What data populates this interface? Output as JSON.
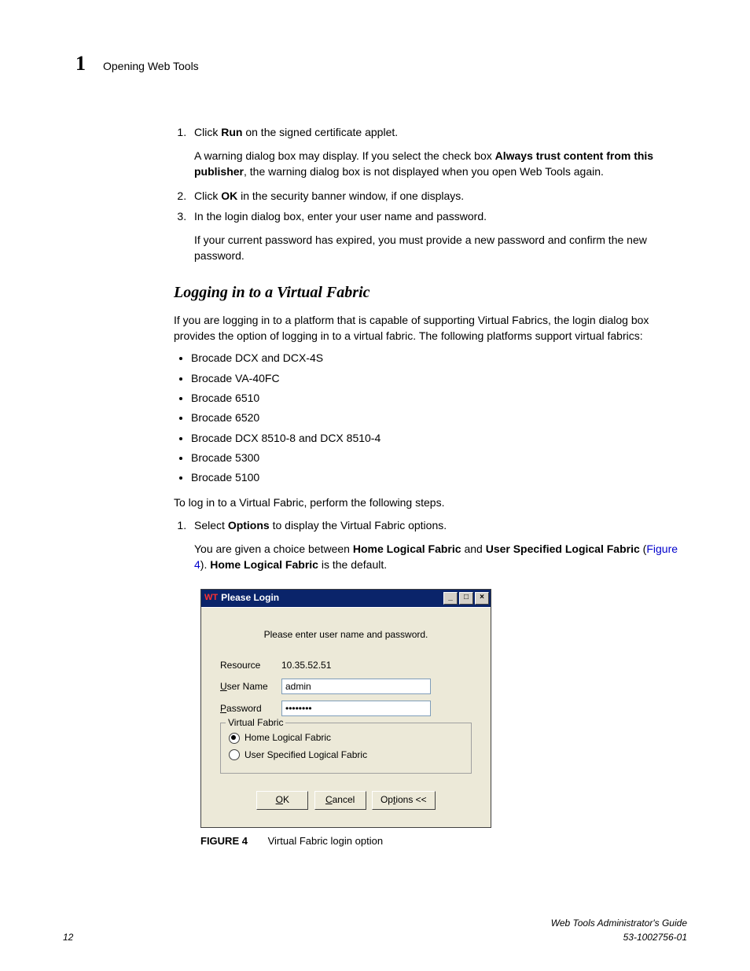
{
  "header": {
    "chapter_number": "1",
    "section_title": "Opening Web Tools"
  },
  "step1": {
    "num": "1.",
    "pre": "Click ",
    "bold": "Run",
    "post": " on the signed certificate applet.",
    "note_pre": "A warning dialog box may display. If you select the check box ",
    "note_bold": "Always trust content from this publisher",
    "note_post": ", the warning dialog box is not displayed when you open Web Tools again."
  },
  "step2": {
    "pre": "Click ",
    "bold": "OK",
    "post": " in the security banner window, if one displays."
  },
  "step3": {
    "text": "In the login dialog box, enter your user name and password.",
    "note": "If your current password has expired, you must provide a new password and confirm the new password."
  },
  "heading2": "Logging in to a Virtual Fabric",
  "vf_intro": "If you are logging in to a platform that is capable of supporting Virtual Fabrics, the login dialog box provides the option of logging in to a virtual fabric. The following platforms support virtual fabrics:",
  "vf_platforms": [
    "Brocade DCX and DCX-4S",
    "Brocade VA-40FC",
    "Brocade 6510",
    "Brocade 6520",
    "Brocade DCX 8510-8 and DCX 8510-4",
    "Brocade 5300",
    "Brocade 5100"
  ],
  "vf_lead": "To log in to a Virtual Fabric, perform the following steps.",
  "vf_step1": {
    "pre": "Select ",
    "bold": "Options",
    "post": " to display the Virtual Fabric options.",
    "choice_pre": "You are given a choice between ",
    "choice_b1": "Home Logical Fabric",
    "choice_mid": " and ",
    "choice_b2": "User Specified Logical Fabric",
    "figref_open": " (",
    "figref": "Figure 4",
    "figref_close": "). ",
    "default_b": "Home Logical Fabric",
    "default_post": " is the default."
  },
  "dialog": {
    "wt_mark": "WT",
    "title": "Please Login",
    "prompt": "Please enter user name and password.",
    "resource_label": "Resource",
    "resource_value": "10.35.52.51",
    "username_label_u": "U",
    "username_label_rest": "ser Name",
    "username_value": "admin",
    "password_label_u": "P",
    "password_label_rest": "assword",
    "password_value": "••••••••",
    "fieldset_label": "Virtual Fabric",
    "radio1": "Home Logical Fabric",
    "radio2": "User Specified Logical Fabric",
    "ok_u": "O",
    "ok_rest": "K",
    "cancel_u": "C",
    "cancel_rest": "ancel",
    "options_label": "Options <<",
    "options_u": "t"
  },
  "figure": {
    "label": "FIGURE 4",
    "caption": "Virtual Fabric login option"
  },
  "footer": {
    "page": "12",
    "doc_title": "Web Tools Administrator's Guide",
    "doc_num": "53-1002756-01"
  }
}
